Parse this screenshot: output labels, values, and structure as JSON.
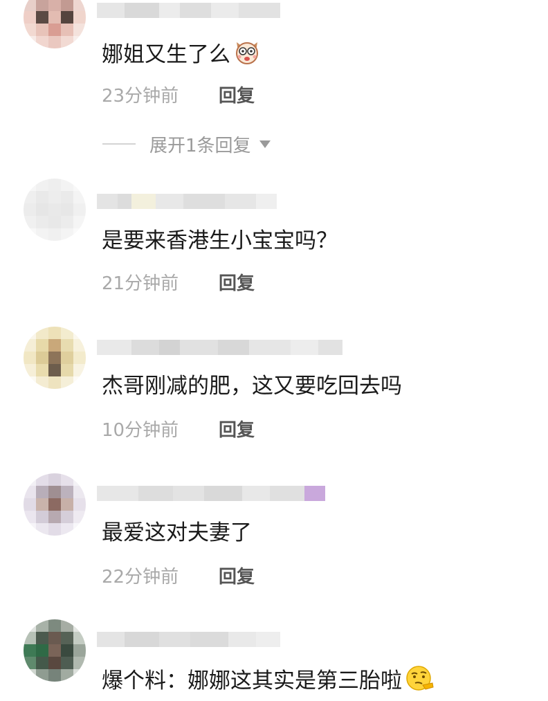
{
  "comments": [
    {
      "text": "娜姐又生了么",
      "time": "23分钟前",
      "reply_label": "回复",
      "expand_label": "展开1条回复",
      "emoji": "dog-emoji"
    },
    {
      "text": "是要来香港生小宝宝吗？",
      "time": "21分钟前",
      "reply_label": "回复"
    },
    {
      "text": "杰哥刚减的肥，这又要吃回去吗",
      "time": "10分钟前",
      "reply_label": "回复"
    },
    {
      "text": "最爱这对夫妻了",
      "time": "22分钟前",
      "reply_label": "回复"
    },
    {
      "text": "爆个料：娜娜这其实是第三胎啦",
      "emoji": "thinking-face-emoji"
    }
  ],
  "colors": {
    "text": "#1a1a1a",
    "time": "#a9a9a9",
    "reply": "#555555",
    "expand": "#9a9a9a"
  }
}
